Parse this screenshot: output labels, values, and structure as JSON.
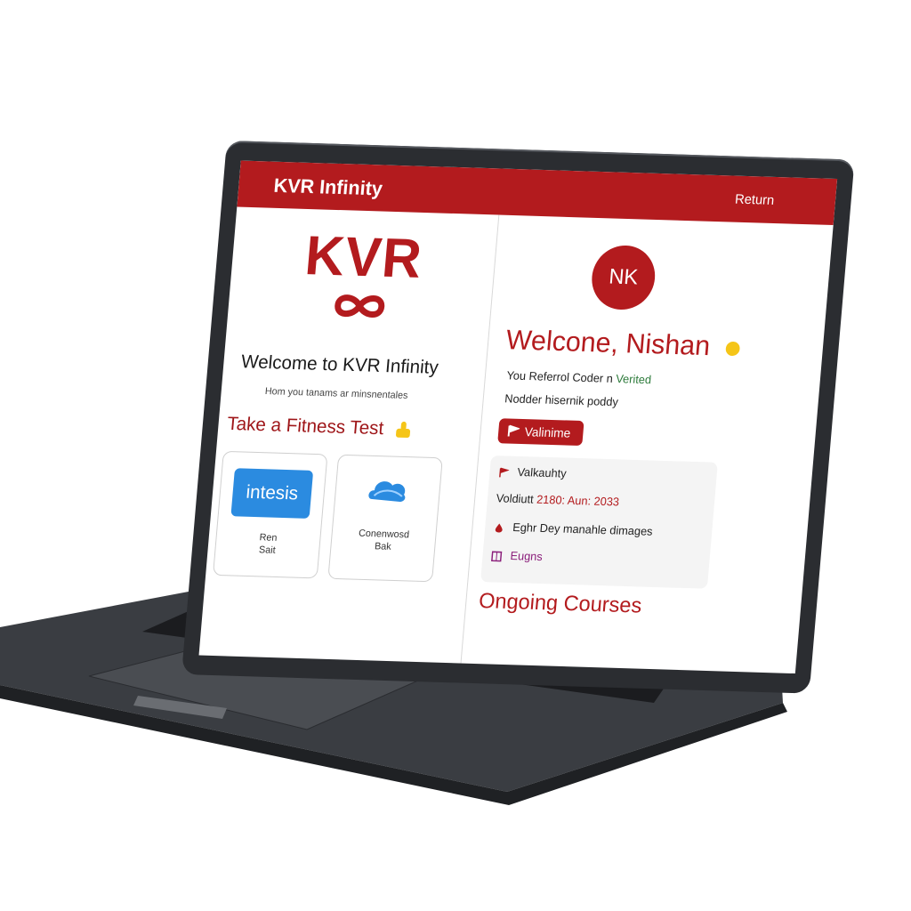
{
  "header": {
    "title": "KVR Infinity",
    "return_label": "Return"
  },
  "brand": {
    "logo_text": "KVR"
  },
  "left": {
    "welcome_title": "Welcome to KVR Infinity",
    "welcome_subtitle": "Hom you tanams ar minsnentales",
    "fitness_heading": "Take a Fitness Test",
    "cards": [
      {
        "logo_text": "intesis",
        "label_line1": "Ren",
        "label_line2": "Sait"
      },
      {
        "label_line1": "Conenwosd",
        "label_line2": "Bak"
      }
    ]
  },
  "right": {
    "avatar_initials": "NK",
    "greeting": "Welcone, Nishan",
    "referral_prefix": "You Referrol Coder n",
    "referral_status": "Verited",
    "nodder_text": "Nodder hisernik poddy",
    "validate_label": "Valinime",
    "details": {
      "validity": "Valkauhty",
      "date_prefix": "Voldiutt",
      "date_value": "2180: Aun: 2033",
      "eight_day": "Eghr Dey manahle dimages",
      "edges": "Eugns"
    },
    "ongoing_heading": "Ongoing Courses"
  },
  "colors": {
    "brand_red": "#b31b1e",
    "intesis_blue": "#2b8be0",
    "laptop_gray": "#2b2d31"
  }
}
